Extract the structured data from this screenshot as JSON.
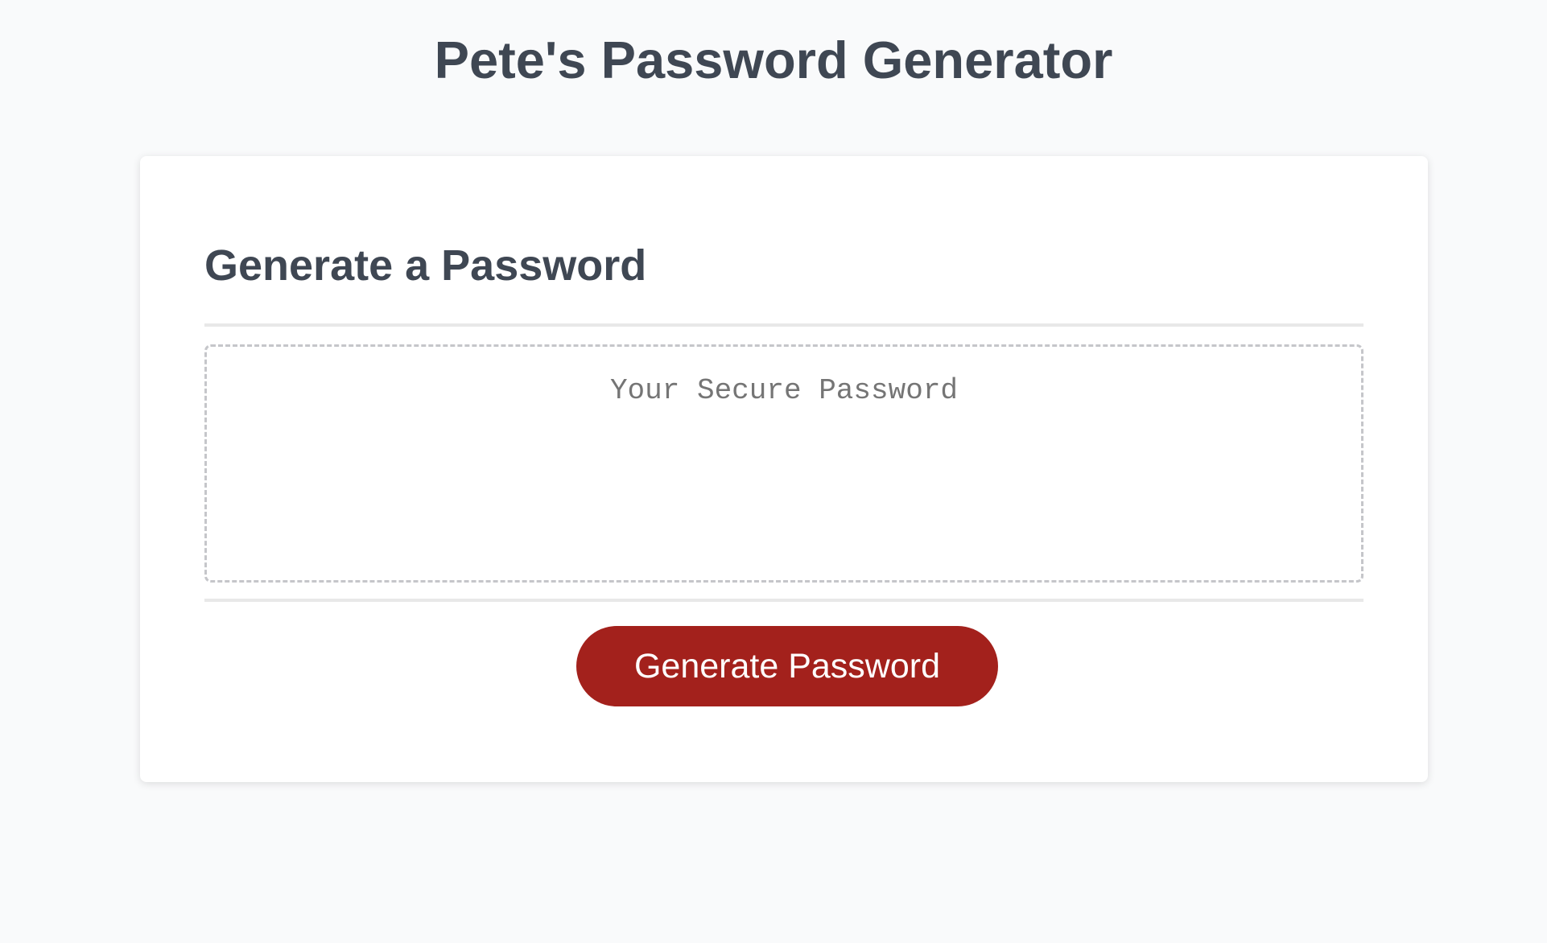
{
  "header": {
    "title": "Pete's Password Generator"
  },
  "card": {
    "heading": "Generate a Password",
    "password_output": {
      "value": "",
      "placeholder": "Your Secure Password"
    },
    "generate_button_label": "Generate Password"
  },
  "colors": {
    "page_background": "#f9fafb",
    "text": "#3f4753",
    "button_background": "#a3211c",
    "button_text": "#ffffff",
    "output_border": "#c5c6ca",
    "divider": "#e8e8e8"
  }
}
